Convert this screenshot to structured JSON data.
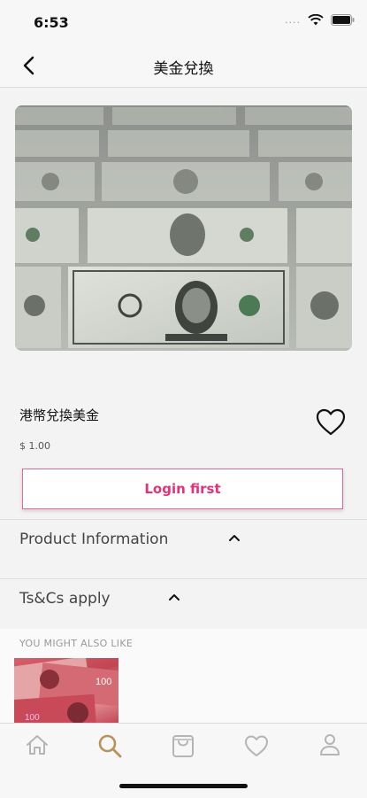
{
  "status_bar": {
    "time": "6:53",
    "signal": "....",
    "icons": [
      "wifi-icon",
      "battery-icon"
    ]
  },
  "nav": {
    "title": "美金兌換",
    "back_icon": "chevron-left-icon"
  },
  "product": {
    "name": "港幣兌換美金",
    "price": "$ 1.00",
    "image": "us-dollar-bills",
    "favorite_icon": "heart-outline-icon"
  },
  "login_button": {
    "label": "Login first",
    "color": "#e2337a"
  },
  "sections": [
    {
      "title": "Product Information",
      "icon": "chevron-up-icon"
    },
    {
      "title": "Ts&Cs apply",
      "icon": "chevron-up-icon"
    }
  ],
  "recommendations": {
    "label": "YOU MIGHT ALSO LIKE",
    "items": [
      {
        "image": "chinese-yuan-bills"
      }
    ]
  },
  "tab_bar": {
    "items": [
      {
        "icon": "home-icon",
        "active": false
      },
      {
        "icon": "search-icon",
        "active": true
      },
      {
        "icon": "bag-icon",
        "active": false
      },
      {
        "icon": "heart-icon",
        "active": false
      },
      {
        "icon": "profile-icon",
        "active": false
      }
    ],
    "active_color": "#b8925a",
    "inactive_color": "#b5b5b5"
  }
}
